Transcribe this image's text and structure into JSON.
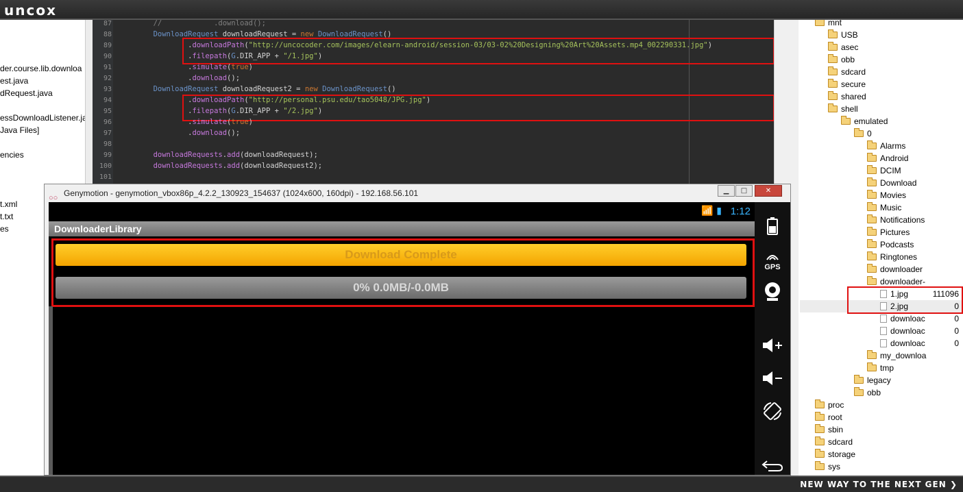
{
  "brand": {
    "logo": "uncox",
    "slogan": "NEW WAY TO THE NEXT GEN ❯"
  },
  "left_panel": {
    "lines": [
      "der.course.lib.downloa",
      "est.java",
      "dRequest.java",
      "essDownloadListener.jav",
      "Java Files]",
      "encies",
      "t.xml",
      "t.txt",
      "es"
    ]
  },
  "editor": {
    "lines": [
      {
        "num": "87",
        "parts": [
          [
            "c-comment",
            "        //            .download();"
          ]
        ]
      },
      {
        "num": "88",
        "parts": [
          [
            "c-type",
            "        DownloadRequest "
          ],
          [
            "c-plain",
            "downloadRequest = "
          ],
          [
            "c-kw",
            "new "
          ],
          [
            "c-type",
            "DownloadRequest"
          ],
          [
            "c-plain",
            "()"
          ]
        ]
      },
      {
        "num": "89",
        "parts": [
          [
            "c-plain",
            "                ."
          ],
          [
            "c-meth",
            "downloadPath"
          ],
          [
            "c-plain",
            "("
          ],
          [
            "c-str",
            "\"http://uncocoder.com/images/elearn-android/session-03/03-02%20Designing%20Art%20Assets.mp4_002290331.jpg\""
          ],
          [
            "c-plain",
            ")"
          ]
        ]
      },
      {
        "num": "90",
        "parts": [
          [
            "c-plain",
            "                ."
          ],
          [
            "c-meth",
            "filepath"
          ],
          [
            "c-plain",
            "("
          ],
          [
            "c-type",
            "G"
          ],
          [
            "c-plain",
            ".DIR_APP + "
          ],
          [
            "c-str",
            "\"/1.jpg\""
          ],
          [
            "c-plain",
            ")"
          ]
        ]
      },
      {
        "num": "91",
        "parts": [
          [
            "c-plain",
            "                ."
          ],
          [
            "c-meth",
            "simulate"
          ],
          [
            "c-plain",
            "("
          ],
          [
            "c-kw",
            "true"
          ],
          [
            "c-plain",
            ")"
          ]
        ]
      },
      {
        "num": "92",
        "parts": [
          [
            "c-plain",
            "                ."
          ],
          [
            "c-meth",
            "download"
          ],
          [
            "c-plain",
            "();"
          ]
        ]
      },
      {
        "num": "93",
        "parts": [
          [
            "c-type",
            "        DownloadRequest "
          ],
          [
            "c-plain",
            "downloadRequest2 = "
          ],
          [
            "c-kw",
            "new "
          ],
          [
            "c-type",
            "DownloadRequest"
          ],
          [
            "c-plain",
            "()"
          ]
        ]
      },
      {
        "num": "94",
        "parts": [
          [
            "c-plain",
            "                ."
          ],
          [
            "c-meth",
            "downloadPath"
          ],
          [
            "c-plain",
            "("
          ],
          [
            "c-str",
            "\"http://personal.psu.edu/tao5048/JPG.jpg\""
          ],
          [
            "c-plain",
            ")"
          ]
        ]
      },
      {
        "num": "95",
        "parts": [
          [
            "c-plain",
            "                ."
          ],
          [
            "c-meth",
            "filepath"
          ],
          [
            "c-plain",
            "("
          ],
          [
            "c-type",
            "G"
          ],
          [
            "c-plain",
            ".DIR_APP + "
          ],
          [
            "c-str",
            "\"/2.jpg\""
          ],
          [
            "c-plain",
            ")"
          ]
        ]
      },
      {
        "num": "96",
        "parts": [
          [
            "c-plain",
            "                ."
          ],
          [
            "c-meth",
            "simulate"
          ],
          [
            "c-plain",
            "("
          ],
          [
            "c-kw",
            "true"
          ],
          [
            "c-plain",
            ")"
          ]
        ]
      },
      {
        "num": "97",
        "parts": [
          [
            "c-plain",
            "                ."
          ],
          [
            "c-meth",
            "download"
          ],
          [
            "c-plain",
            "();"
          ]
        ]
      },
      {
        "num": "98",
        "parts": [
          [
            "c-plain",
            ""
          ]
        ]
      },
      {
        "num": "99",
        "parts": [
          [
            "c-meth",
            "        downloadRequests"
          ],
          [
            "c-plain",
            "."
          ],
          [
            "c-meth",
            "add"
          ],
          [
            "c-plain",
            "(downloadRequest);"
          ]
        ]
      },
      {
        "num": "100",
        "parts": [
          [
            "c-meth",
            "        downloadRequests"
          ],
          [
            "c-plain",
            "."
          ],
          [
            "c-meth",
            "add"
          ],
          [
            "c-plain",
            "(downloadRequest2);"
          ]
        ]
      },
      {
        "num": "101",
        "parts": [
          [
            "c-plain",
            ""
          ]
        ]
      }
    ]
  },
  "genymotion": {
    "title": "Genymotion - genymotion_vbox86p_4.2.2_130923_154637 (1024x600, 160dpi) - 192.168.56.101",
    "logo": "○○",
    "buttons": {
      "minimize": "▁",
      "maximize": "□",
      "close": "✕"
    },
    "status_time": "1:12",
    "status_icons": "📶 ▮",
    "app_title": "DownloaderLibrary",
    "complete_label": "Download Complete",
    "progress_label": "0% 0.0MB/-0.0MB",
    "progress_fraction": 0,
    "sidebar": {
      "battery_icon": "battery-icon",
      "gps_label": "GPS",
      "camera_icon": "camera-icon",
      "volume_up_icon": "volume-up-icon",
      "volume_down_icon": "volume-down-icon",
      "rotate_icon": "rotate-icon",
      "back_icon": "back-icon"
    }
  },
  "tree": {
    "nodes": [
      {
        "label": "mnt",
        "type": "folder",
        "level": 0
      },
      {
        "label": "USB",
        "type": "folder",
        "level": 1
      },
      {
        "label": "asec",
        "type": "folder",
        "level": 1
      },
      {
        "label": "obb",
        "type": "folder",
        "level": 1
      },
      {
        "label": "sdcard",
        "type": "folder",
        "level": 1
      },
      {
        "label": "secure",
        "type": "folder",
        "level": 1
      },
      {
        "label": "shared",
        "type": "folder",
        "level": 1
      },
      {
        "label": "shell",
        "type": "folder",
        "level": 1
      },
      {
        "label": "emulated",
        "type": "folder",
        "level": 2
      },
      {
        "label": "0",
        "type": "folder",
        "level": 3
      },
      {
        "label": "Alarms",
        "type": "folder",
        "level": 4
      },
      {
        "label": "Android",
        "type": "folder",
        "level": 4
      },
      {
        "label": "DCIM",
        "type": "folder",
        "level": 4
      },
      {
        "label": "Download",
        "type": "folder",
        "level": 4
      },
      {
        "label": "Movies",
        "type": "folder",
        "level": 4
      },
      {
        "label": "Music",
        "type": "folder",
        "level": 4
      },
      {
        "label": "Notifications",
        "type": "folder",
        "level": 4
      },
      {
        "label": "Pictures",
        "type": "folder",
        "level": 4
      },
      {
        "label": "Podcasts",
        "type": "folder",
        "level": 4
      },
      {
        "label": "Ringtones",
        "type": "folder",
        "level": 4
      },
      {
        "label": "downloader",
        "type": "folder",
        "level": 4
      },
      {
        "label": "downloader-",
        "type": "folder",
        "level": 4
      },
      {
        "label": "1.jpg",
        "type": "file",
        "level": 5,
        "size": "111096"
      },
      {
        "label": "2.jpg",
        "type": "file",
        "level": 5,
        "size": "0"
      },
      {
        "label": "downloac",
        "type": "file",
        "level": 5,
        "size": "0"
      },
      {
        "label": "downloac",
        "type": "file",
        "level": 5,
        "size": "0"
      },
      {
        "label": "downloac",
        "type": "file",
        "level": 5,
        "size": "0"
      },
      {
        "label": "my_downloa",
        "type": "folder",
        "level": 4
      },
      {
        "label": "tmp",
        "type": "folder",
        "level": 4
      },
      {
        "label": "legacy",
        "type": "folder",
        "level": 3
      },
      {
        "label": "obb",
        "type": "folder",
        "level": 3
      },
      {
        "label": "proc",
        "type": "folder",
        "level": 0
      },
      {
        "label": "root",
        "type": "folder",
        "level": 0
      },
      {
        "label": "sbin",
        "type": "folder",
        "level": 0
      },
      {
        "label": "sdcard",
        "type": "folder",
        "level": 0
      },
      {
        "label": "storage",
        "type": "folder",
        "level": 0
      },
      {
        "label": "sys",
        "type": "folder",
        "level": 0
      }
    ]
  }
}
